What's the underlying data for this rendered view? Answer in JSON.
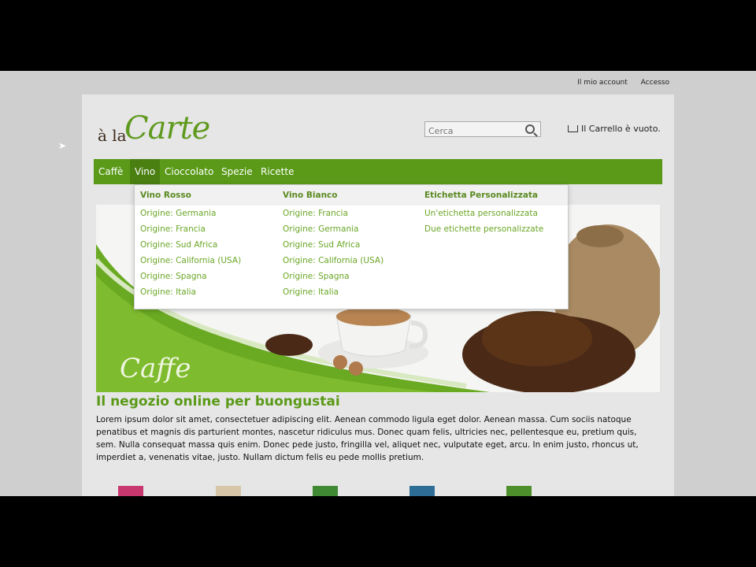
{
  "header": {
    "account_link": "Il mio account",
    "login_link": "Accesso",
    "logo_prefix": "à la",
    "logo_word": "Carte",
    "search_placeholder": "Cerca",
    "cart_text": "Il Carrello è vuoto."
  },
  "nav": {
    "items": [
      "Caffè",
      "Vino",
      "Cioccolato",
      "Spezie",
      "Ricette"
    ],
    "active": "Vino"
  },
  "dropdown": {
    "columns": [
      {
        "title": "Vino Rosso",
        "links": [
          "Origine: Germania",
          "Origine: Francia",
          "Origine: Sud Africa",
          "Origine: California (USA)",
          "Origine: Spagna",
          "Origine: Italia"
        ]
      },
      {
        "title": "Vino Bianco",
        "links": [
          "Origine: Francia",
          "Origine: Germania",
          "Origine: Sud Africa",
          "Origine: California (USA)",
          "Origine: Spagna",
          "Origine: Italia"
        ]
      },
      {
        "title": "Etichetta Personalizzata",
        "links": [
          "Un'etichetta personalizzata",
          "Due etichette personalizzate"
        ]
      }
    ]
  },
  "hero": {
    "caption": "Caffe"
  },
  "main": {
    "heading": "Il negozio online per buongustai",
    "body": "Lorem ipsum dolor sit amet, consectetuer adipiscing elit. Aenean commodo ligula eget dolor. Aenean massa. Cum sociis natoque penatibus et magnis dis parturient montes, nascetur ridiculus mus. Donec quam felis, ultricies nec, pellentesque eu, pretium quis, sem. Nulla consequat massa quis enim. Donec pede justo, fringilla vel, aliquet nec, vulputate eget, arcu. In enim justo, rhoncus ut, imperdiet a, venenatis vitae, justo. Nullam dictum felis eu pede mollis pretium."
  },
  "colors": {
    "brand_green": "#5a9a18",
    "link_green": "#6aa626",
    "product_thumbs": [
      "#c8376e",
      "#d7c7a8",
      "#3f8a32",
      "#2e6d96",
      "#4d8f2a"
    ]
  }
}
